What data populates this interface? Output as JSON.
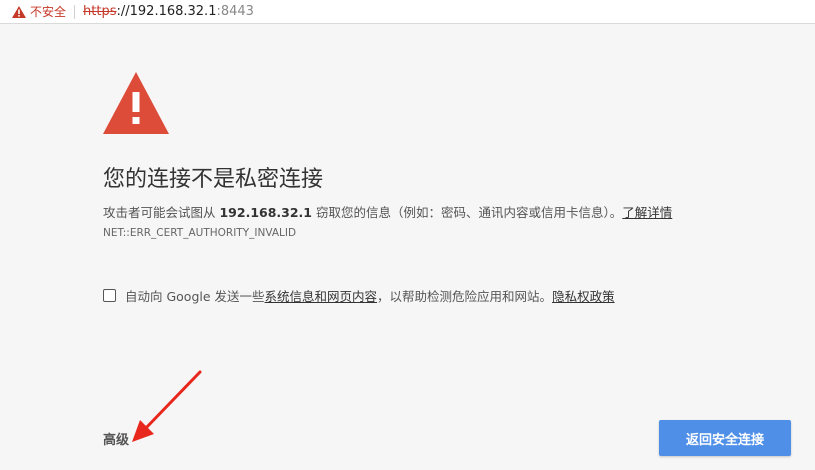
{
  "addressbar": {
    "security_label": "不安全",
    "scheme": "https",
    "scheme_sep": "://",
    "host": "192.168.32.1",
    "port": ":8443"
  },
  "interstitial": {
    "title": "您的连接不是私密连接",
    "desc_prefix": "攻击者可能会试图从 ",
    "desc_ip": "192.168.32.1",
    "desc_suffix": " 窃取您的信息（例如：密码、通讯内容或信用卡信息）。",
    "learn_more": "了解详情",
    "error_code": "NET::ERR_CERT_AUTHORITY_INVALID",
    "reporting_prefix": "自动向 Google 发送一些",
    "reporting_link": "系统信息和网页内容",
    "reporting_middle": "，以帮助检测危险应用和网站。",
    "privacy_link": "隐私权政策",
    "advanced": "高级",
    "back_button": "返回安全连接"
  },
  "colors": {
    "warning_red": "#dd4b39",
    "button_blue": "#4f8fe8",
    "annotation_red": "#e8271d"
  }
}
